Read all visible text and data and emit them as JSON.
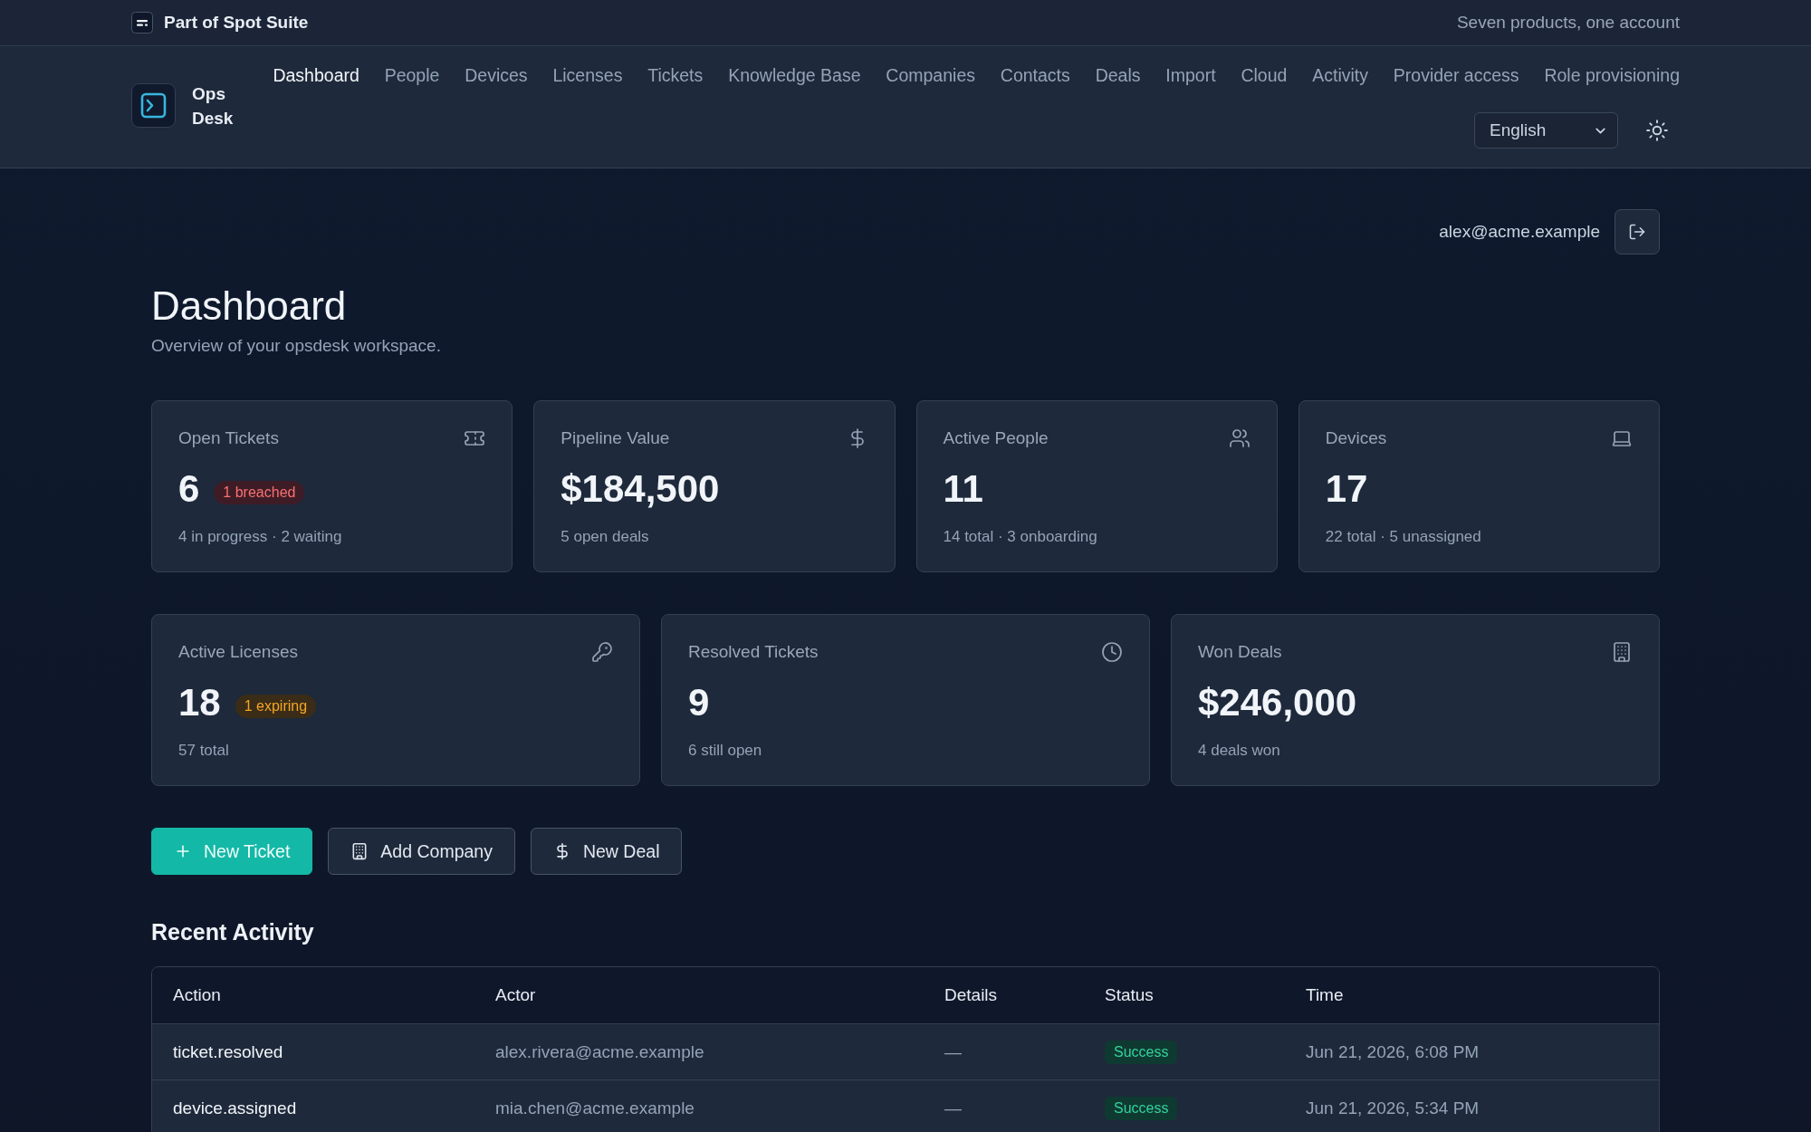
{
  "suite_bar": {
    "title": "Part of Spot Suite",
    "tagline": "Seven products, one account"
  },
  "header": {
    "brand": "Ops Desk",
    "nav": [
      {
        "label": "Dashboard",
        "selected": true
      },
      {
        "label": "People",
        "selected": false
      },
      {
        "label": "Devices",
        "selected": false
      },
      {
        "label": "Licenses",
        "selected": false
      },
      {
        "label": "Tickets",
        "selected": false
      },
      {
        "label": "Knowledge Base",
        "selected": false
      },
      {
        "label": "Companies",
        "selected": false
      },
      {
        "label": "Contacts",
        "selected": false
      },
      {
        "label": "Deals",
        "selected": false
      },
      {
        "label": "Import",
        "selected": false
      },
      {
        "label": "Cloud",
        "selected": false
      },
      {
        "label": "Activity",
        "selected": false
      },
      {
        "label": "Provider access",
        "selected": false
      },
      {
        "label": "Role provisioning",
        "selected": false
      }
    ],
    "language": "English"
  },
  "account": {
    "email": "alex@acme.example"
  },
  "page": {
    "title": "Dashboard",
    "subtitle": "Overview of your opsdesk workspace."
  },
  "stat_rows": [
    {
      "cards": [
        {
          "label": "Open Tickets",
          "value": "6",
          "badge": {
            "text": "1 breached",
            "kind": "danger"
          },
          "detail": "4 in progress · 2 waiting"
        },
        {
          "label": "Pipeline Value",
          "value": "$184,500",
          "detail": "5 open deals"
        },
        {
          "label": "Active People",
          "value": "11",
          "detail": "14 total · 3 onboarding"
        },
        {
          "label": "Devices",
          "value": "17",
          "detail": "22 total · 5 unassigned"
        }
      ]
    },
    {
      "cards": [
        {
          "label": "Active Licenses",
          "value": "18",
          "badge": {
            "text": "1 expiring",
            "kind": "warning"
          },
          "detail": "57 total"
        },
        {
          "label": "Resolved Tickets",
          "value": "9",
          "detail": "6 still open"
        },
        {
          "label": "Won Deals",
          "value": "$246,000",
          "detail": "4 deals won"
        }
      ]
    }
  ],
  "quick_actions": [
    {
      "label": "New Ticket",
      "kind": "primary"
    },
    {
      "label": "Add Company",
      "kind": "secondary"
    },
    {
      "label": "New Deal",
      "kind": "secondary"
    }
  ],
  "recent_activity": {
    "title": "Recent Activity",
    "columns": [
      "Action",
      "Actor",
      "Details",
      "Status",
      "Time"
    ],
    "rows": [
      {
        "action": "ticket.resolved",
        "actor": "alex.rivera@acme.example",
        "details": "—",
        "status": {
          "text": "Success",
          "kind": "success"
        },
        "time": "Jun 21, 2026, 6:08 PM"
      },
      {
        "action": "device.assigned",
        "actor": "mia.chen@acme.example",
        "details": "—",
        "status": {
          "text": "Success",
          "kind": "success"
        },
        "time": "Jun 21, 2026, 5:34 PM"
      }
    ]
  }
}
